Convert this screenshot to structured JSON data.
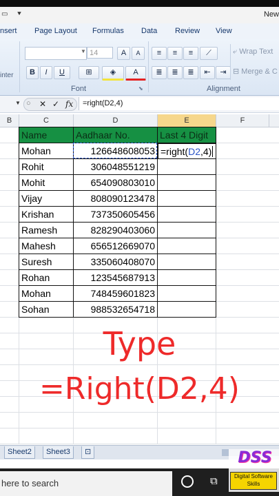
{
  "window": {
    "title_fragment": "New"
  },
  "ribbon": {
    "tabs": [
      "nsert",
      "Page Layout",
      "Formulas",
      "Data",
      "Review",
      "View"
    ],
    "font_size": "14",
    "font_group_label": "Font",
    "alignment_group_label": "Alignment",
    "left_group_fragment": "inter",
    "bold": "B",
    "italic": "I",
    "underline": "U",
    "grow_font": "A",
    "shrink_font": "A",
    "font_color": "A",
    "wrap_text": "Wrap Text",
    "merge": "Merge & C"
  },
  "formula_bar": {
    "fx_label": "fx",
    "cancel": "✕",
    "enter": "✓",
    "formula": "=right(D2,4)"
  },
  "grid": {
    "columns": [
      "B",
      "C",
      "D",
      "E",
      "F"
    ],
    "headers": {
      "name": "Name",
      "aadhaar": "Aadhaar No.",
      "last4": "Last 4 Digit"
    },
    "rows": [
      {
        "name": "Mohan",
        "aadhaar": "126648608053"
      },
      {
        "name": "Rohit",
        "aadhaar": "306048551219"
      },
      {
        "name": "Mohit",
        "aadhaar": "654090803010"
      },
      {
        "name": "Vijay",
        "aadhaar": "808090123478"
      },
      {
        "name": "Krishan",
        "aadhaar": "737350605456"
      },
      {
        "name": "Ramesh",
        "aadhaar": "828290403060"
      },
      {
        "name": "Mahesh",
        "aadhaar": "656512669070"
      },
      {
        "name": "Suresh",
        "aadhaar": "335060408070"
      },
      {
        "name": "Rohan",
        "aadhaar": "123545687913"
      },
      {
        "name": "Mohan",
        "aadhaar": "748459601823"
      },
      {
        "name": "Sohan",
        "aadhaar": "988532654718"
      }
    ],
    "editing_cell": {
      "prefix": "=right(",
      "ref": "D2",
      "suffix": ",4)"
    }
  },
  "overlay": {
    "line1": "Type",
    "line2": "=Right(D2,4)"
  },
  "sheets": [
    "Sheet2",
    "Sheet3"
  ],
  "taskbar": {
    "search_placeholder": "here to search"
  },
  "logo": {
    "text": "DSS",
    "caption_1": "Digital Software",
    "caption_2": "Skills"
  }
}
